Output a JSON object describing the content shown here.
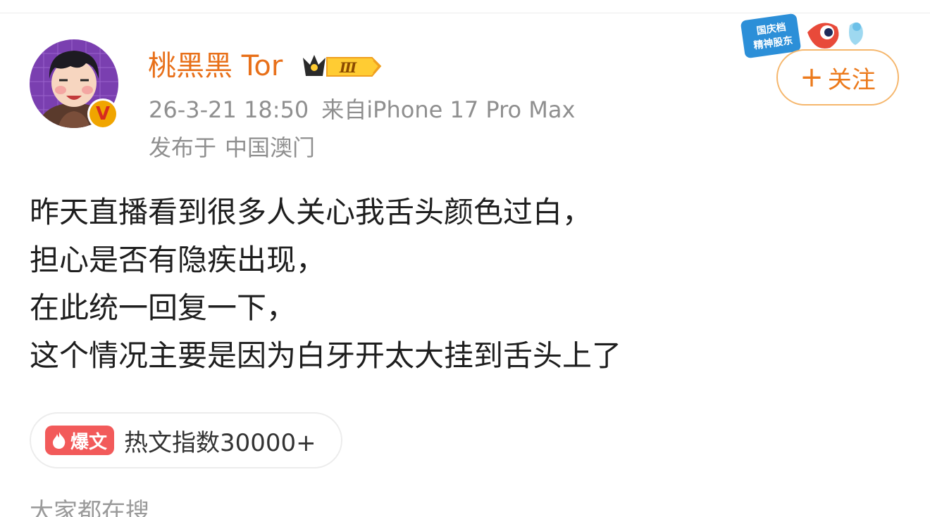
{
  "user": {
    "name": "桃黑黑 Tor",
    "vip_level": "Ⅲ",
    "verified_mark": "V"
  },
  "meta": {
    "timestamp": "26-3-21 18:50",
    "source": "来自iPhone 17 Pro Max",
    "location_prefix": "发布于",
    "location": "中国澳门"
  },
  "header": {
    "event_badge_line1": "国庆档",
    "event_badge_line2": "精神股东",
    "follow_plus": "+",
    "follow_label": "关注"
  },
  "post": {
    "lines": [
      "昨天直播看到很多人关心我舌头颜色过白，",
      "担心是否有隐疾出现，",
      "在此统一回复一下，",
      "这个情况主要是因为白牙开太大挂到舌头上了"
    ]
  },
  "hot_tag": {
    "badge": "爆文",
    "text": "热文指数30000+"
  },
  "trending": {
    "title": "大家都在搜"
  },
  "colors": {
    "username": "#e8701a",
    "follow_border": "#f5b66c",
    "hot_badge": "#f25a5a",
    "meta_text": "#8f8f8f"
  }
}
